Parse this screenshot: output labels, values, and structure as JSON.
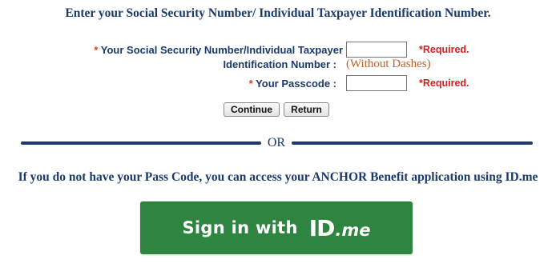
{
  "header": {
    "title": "Enter your Social Security Number/ Individual Taxpayer Identification Number."
  },
  "form": {
    "ssn": {
      "required_marker": "*",
      "label_line1": "Your Social Security Number/Individual Taxpayer",
      "label_line2": "Identification Number :",
      "value": "",
      "required_text": "*Required.",
      "hint": "(Without Dashes)"
    },
    "passcode": {
      "required_marker": "*",
      "label": "Your Passcode :",
      "value": "",
      "required_text": "*Required."
    },
    "continue_label": "Continue",
    "return_label": "Return"
  },
  "divider": {
    "text": "OR"
  },
  "alternative": {
    "text": "If you do not have your Pass Code, you can access your ANCHOR Benefit application using ID.me"
  },
  "idme_button": {
    "text": "Sign in with",
    "logo_id": "ID",
    "logo_me": ".me",
    "color": "#2e8540"
  },
  "colors": {
    "heading": "#1a3a6b",
    "required": "#d31f1f",
    "hint": "#c0622a"
  }
}
